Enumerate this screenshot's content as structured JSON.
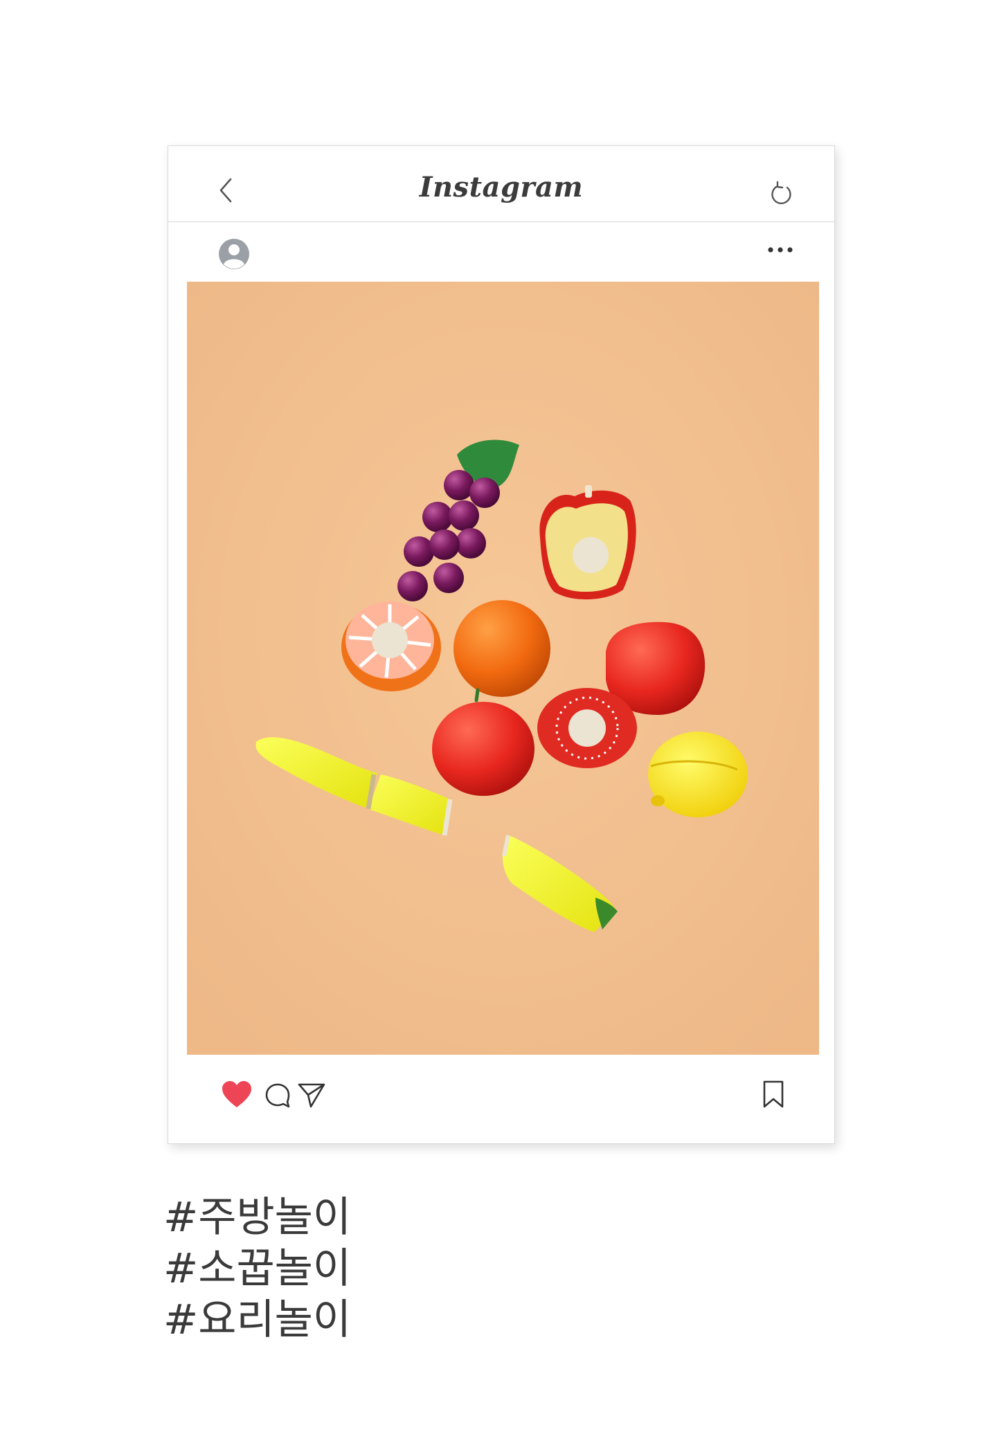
{
  "header": {
    "title": "Instagram",
    "back_icon": "chevron-left-icon",
    "refresh_icon": "refresh-icon"
  },
  "post": {
    "avatar_icon": "user-avatar-icon",
    "more_icon": "more-horizontal-icon",
    "image_alt": "Wooden toy fruit set: grapes, apple half, orange slice, orange, red apple, tomatoes, banana pieces, lemon on peach background"
  },
  "actions": {
    "like_icon": "heart-filled-icon",
    "comment_icon": "comment-icon",
    "share_icon": "send-icon",
    "save_icon": "bookmark-icon",
    "like_color": "#ee4556"
  },
  "hashtags": [
    "#주방놀이",
    "#소꿉놀이",
    "#요리놀이"
  ],
  "colors": {
    "background": "#f1bf8f",
    "border": "#d8d8d8"
  }
}
